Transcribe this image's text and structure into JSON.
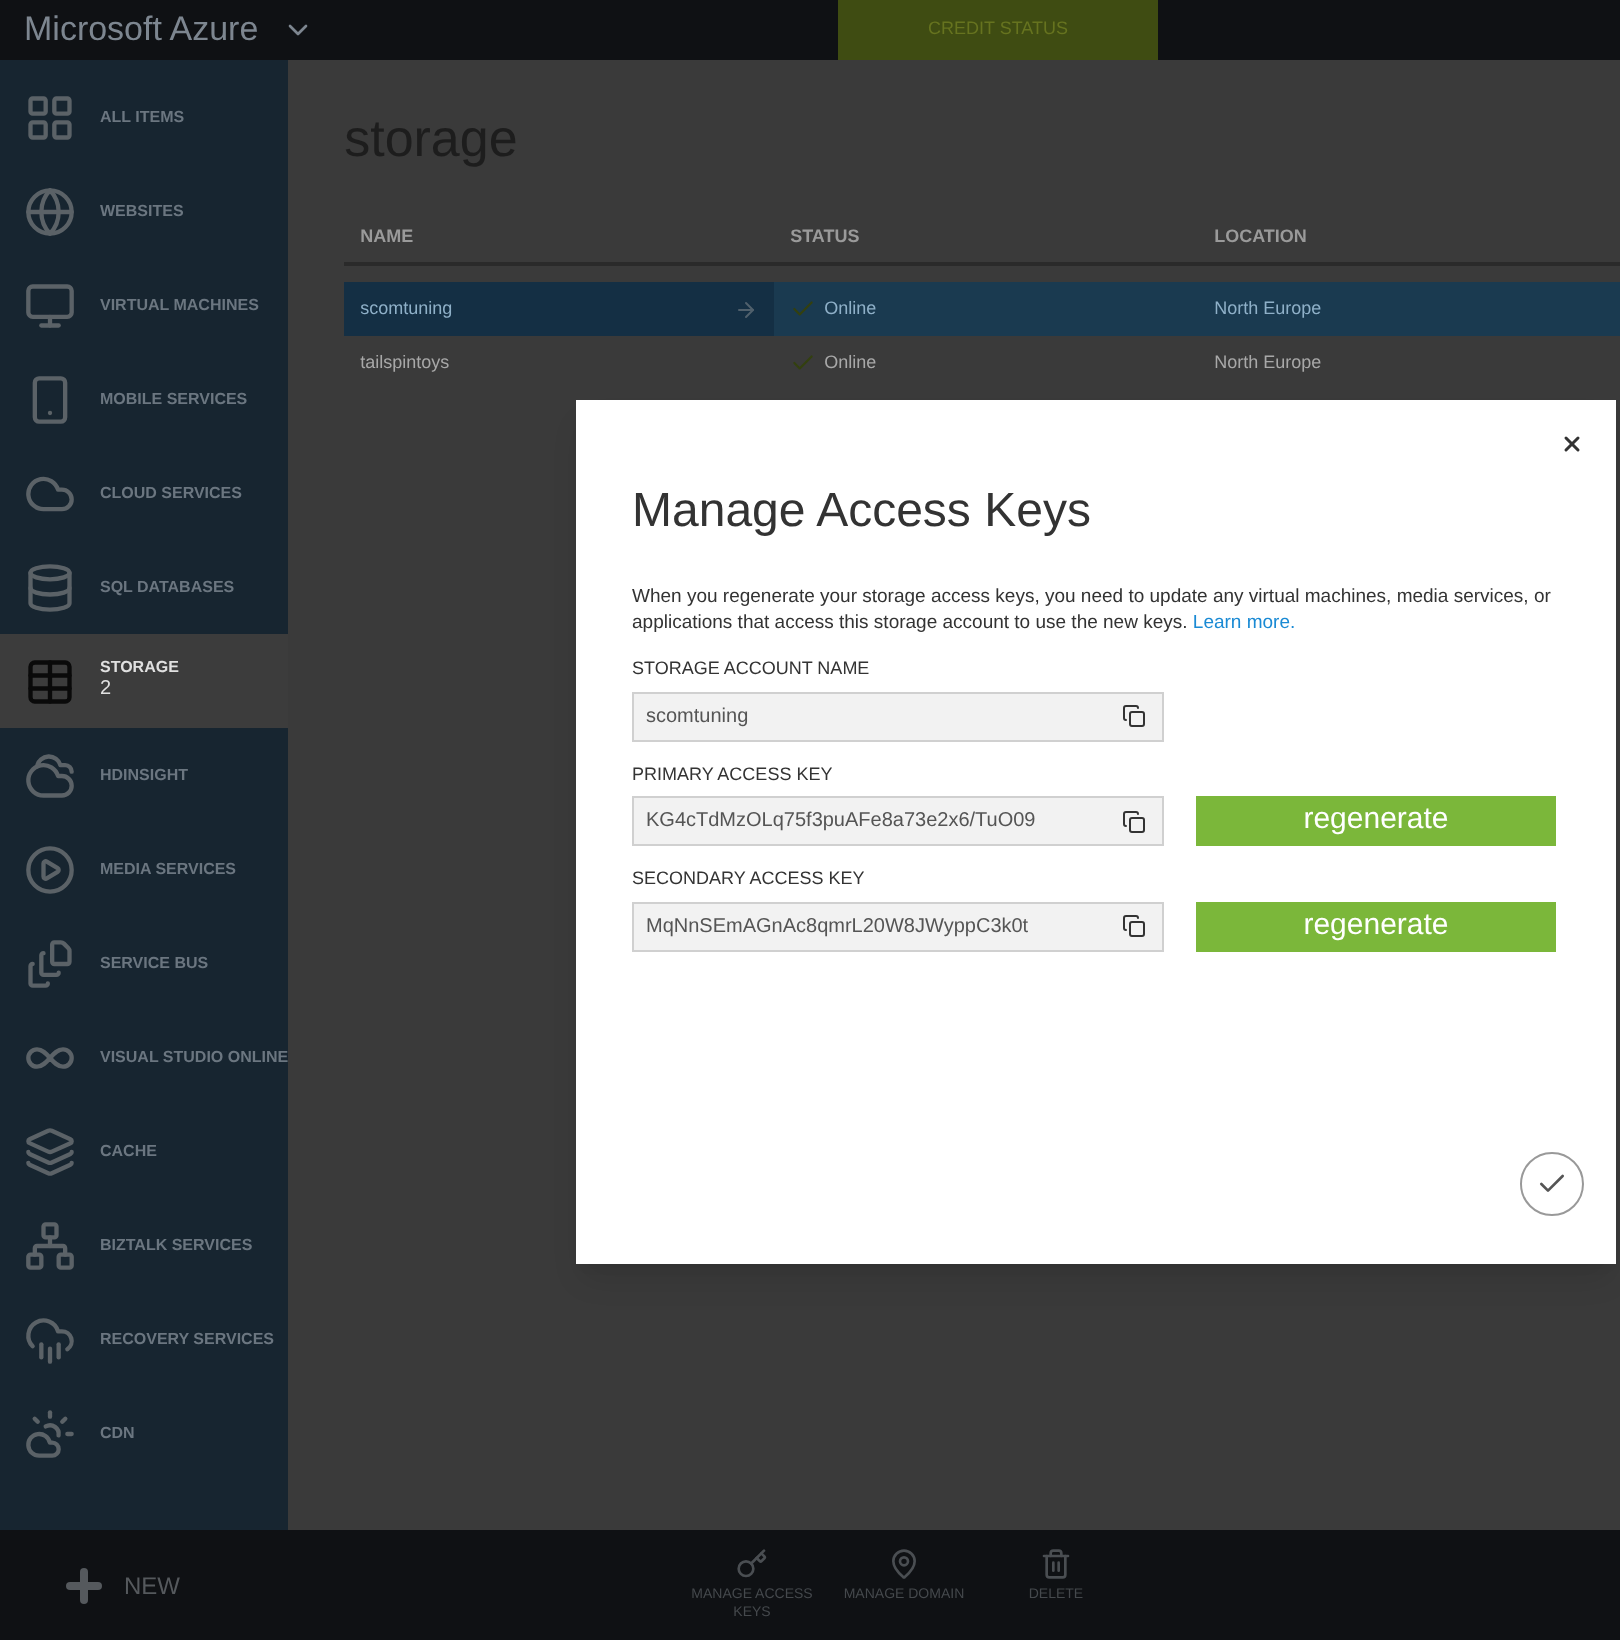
{
  "header": {
    "brand": "Microsoft Azure",
    "credit_status": "CREDIT STATUS"
  },
  "sidebar": {
    "items": [
      {
        "label": "ALL ITEMS",
        "selected": false
      },
      {
        "label": "WEBSITES",
        "selected": false
      },
      {
        "label": "VIRTUAL MACHINES",
        "selected": false
      },
      {
        "label": "MOBILE SERVICES",
        "selected": false
      },
      {
        "label": "CLOUD SERVICES",
        "selected": false
      },
      {
        "label": "SQL DATABASES",
        "selected": false
      },
      {
        "label": "STORAGE",
        "count": "2",
        "selected": true
      },
      {
        "label": "HDINSIGHT",
        "selected": false
      },
      {
        "label": "MEDIA SERVICES",
        "selected": false
      },
      {
        "label": "SERVICE BUS",
        "selected": false
      },
      {
        "label": "VISUAL STUDIO ONLINE",
        "selected": false
      },
      {
        "label": "CACHE",
        "selected": false
      },
      {
        "label": "BIZTALK SERVICES",
        "selected": false
      },
      {
        "label": "RECOVERY SERVICES",
        "selected": false
      },
      {
        "label": "CDN",
        "selected": false
      }
    ]
  },
  "page": {
    "title": "storage",
    "table": {
      "columns": [
        "NAME",
        "STATUS",
        "LOCATION"
      ],
      "rows": [
        {
          "name": "scomtuning",
          "status": "Online",
          "location": "North Europe",
          "selected": true
        },
        {
          "name": "tailspintoys",
          "status": "Online",
          "location": "North Europe",
          "selected": false
        }
      ]
    }
  },
  "dialog": {
    "title": "Manage Access Keys",
    "description": "When you regenerate your storage access keys, you need to update any virtual machines, media services, or applications that access this storage account to use the new keys.",
    "link": "Learn more.",
    "fields": [
      {
        "label": "STORAGE ACCOUNT NAME",
        "value": "scomtuning"
      },
      {
        "label": "PRIMARY ACCESS KEY",
        "value": "KG4cTdMzOLq75f3puAFe8a73e2x6/TuO09",
        "regenerate": "regenerate"
      },
      {
        "label": "SECONDARY ACCESS KEY",
        "value": "MqNnSEmAGnAc8qmrL20W8JWyppC3k0t",
        "regenerate": "regenerate"
      }
    ]
  },
  "command_bar": {
    "new": "NEW",
    "commands": [
      "MANAGE ACCESS KEYS",
      "MANAGE DOMAIN",
      "DELETE"
    ]
  }
}
